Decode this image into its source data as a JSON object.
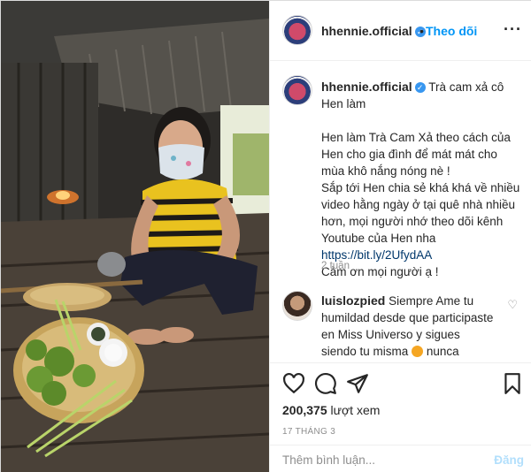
{
  "header": {
    "username": "hhennie.official",
    "separator": "•",
    "follow_label": "Theo dõi",
    "more_icon": "more-options-icon"
  },
  "caption": {
    "username": "hhennie.official",
    "title": "Trà cam xả cô Hen làm",
    "body": "Hen làm Trà Cam Xả theo cách của Hen cho gia đình để mát mát cho mùa khô nắng nóng nè !\nSắp tới Hen chia sẻ khá khá về nhiều video hằng ngày ở tại quê nhà nhiều hơn, mọi người nhớ theo dõi kênh Youtube của Hen nha",
    "link": "https://bit.ly/2UfydAA",
    "thanks": "Cảm ơn mọi người ạ !",
    "time_ago": "2 tuần"
  },
  "comment": {
    "username": "luislozpied",
    "text_before_emoji": "Siempre Ame tu humildad desde que participaste en Miss Universo y sigues siendo tu misma",
    "text_after_emoji": "nunca cambies eres un ejemplo para todas las"
  },
  "actions": {
    "views_count": "200,375",
    "views_label": "lượt xem",
    "date": "17 THÁNG 3",
    "add_comment_placeholder": "Thêm bình luận...",
    "post_label": "Đăng"
  },
  "colors": {
    "accent": "#0095f6",
    "verified": "#3897f0",
    "post_disabled": "#b2dffc",
    "muted": "#8e8e8e",
    "text": "#262626"
  }
}
